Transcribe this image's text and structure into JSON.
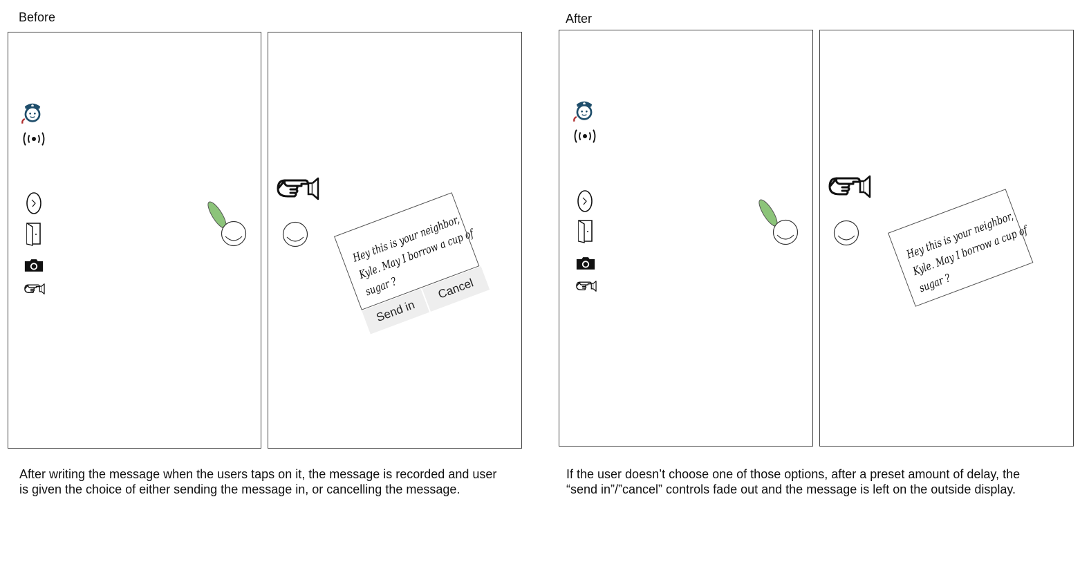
{
  "before": {
    "heading": "Before",
    "caption_lines": [
      "After writing the message when the users taps on it, the message is recorded and user",
      "is given the choice of either sending the message in, or cancelling the message."
    ],
    "message_lines": [
      "Hey this is your neighbor,",
      "Kyle. May I borrow a cup of",
      "sugar ?"
    ],
    "send_label": "Send in",
    "cancel_label": "Cancel"
  },
  "after": {
    "heading": "After",
    "caption_lines": [
      "If the user doesn’t choose one of those options, after a preset amount of delay, the",
      "“send in”/”cancel” controls fade out and the message is left on the outside display."
    ],
    "message_lines": [
      "Hey this is your neighbor,",
      "Kyle. May I borrow a cup of",
      "sugar ?"
    ]
  },
  "colors": {
    "police": "#1f4e6b",
    "finger": "#8cc47a",
    "button_bg": "#eeeeee",
    "border": "#444444"
  },
  "icons": [
    "police-call-icon",
    "alarm-signal-icon",
    "doorbell-icon",
    "door-icon",
    "camera-icon",
    "pointing-speaker-icon"
  ]
}
